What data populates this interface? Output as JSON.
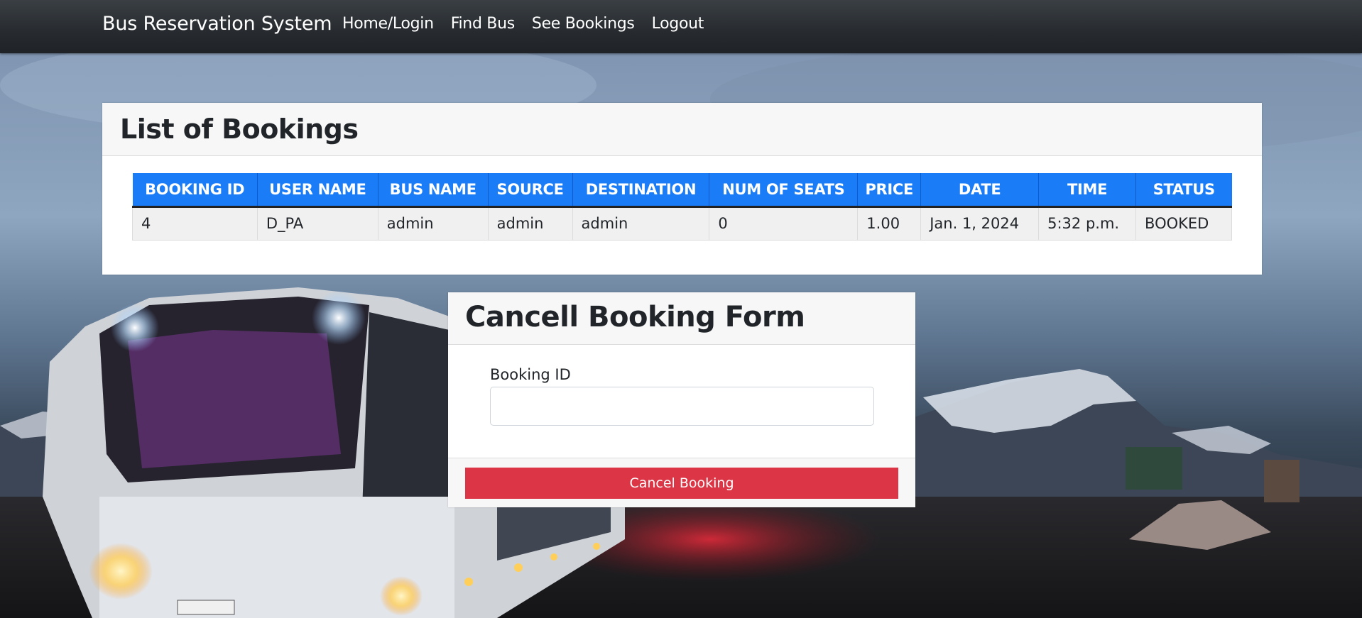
{
  "navbar": {
    "brand": "Bus Reservation System",
    "links": [
      "Home/Login",
      "Find Bus",
      "See Bookings",
      "Logout"
    ]
  },
  "bookings": {
    "title": "List of Bookings",
    "columns": [
      "BOOKING ID",
      "USER NAME",
      "BUS NAME",
      "SOURCE",
      "DESTINATION",
      "NUM OF SEATS",
      "PRICE",
      "DATE",
      "TIME",
      "STATUS"
    ],
    "rows": [
      [
        "4",
        "D_PA",
        "admin",
        "admin",
        "admin",
        "0",
        "1.00",
        "Jan. 1, 2024",
        "5:32 p.m.",
        "BOOKED"
      ]
    ]
  },
  "cancel_form": {
    "title": "Cancell Booking Form",
    "booking_id_label": "Booking ID",
    "booking_id_value": "",
    "submit_label": "Cancel Booking"
  },
  "colors": {
    "navbar": "#272b30",
    "table_header": "#1a7cf7",
    "danger": "#dc3545"
  }
}
